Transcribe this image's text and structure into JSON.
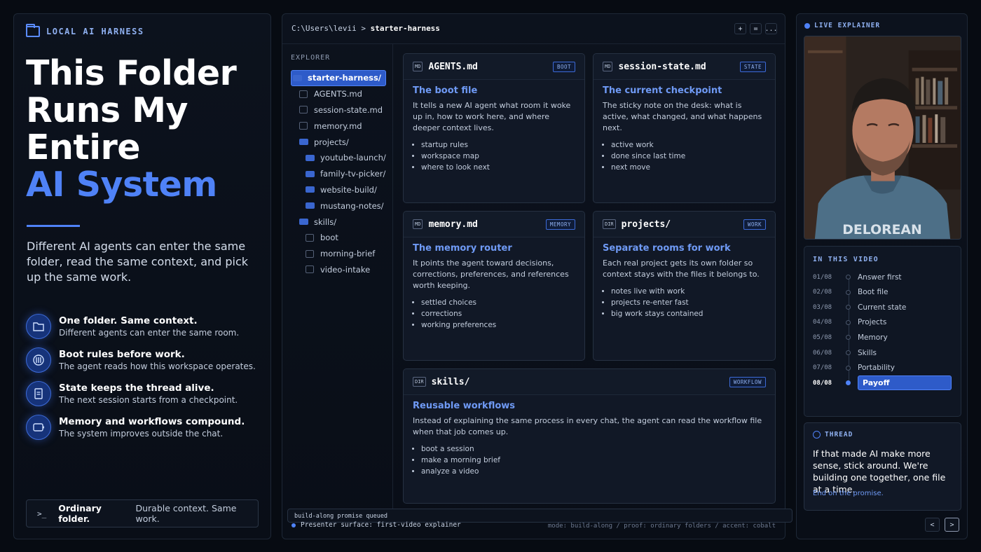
{
  "left": {
    "brand": "LOCAL AI HARNESS",
    "headline": [
      "This Folder",
      "Runs My",
      "Entire"
    ],
    "headline_accent": "AI System",
    "lede": "Different AI agents can enter the same folder, read the same context, and pick up the same work.",
    "features": [
      {
        "icon": "folder-icon",
        "title": "One folder. Same context.",
        "desc": "Different agents can enter the same room."
      },
      {
        "icon": "rules-icon",
        "title": "Boot rules before work.",
        "desc": "The agent reads how this workspace operates."
      },
      {
        "icon": "document-icon",
        "title": "State keeps the thread alive.",
        "desc": "The next session starts from a checkpoint."
      },
      {
        "icon": "workflow-icon",
        "title": "Memory and workflows compound.",
        "desc": "The system improves outside the chat."
      }
    ],
    "footer": {
      "prompt": ">_",
      "bold": "Ordinary folder.",
      "rest": "Durable context. Same work."
    }
  },
  "center": {
    "path_prefix": "C:\\Users\\levii > ",
    "path_current": "starter-harness",
    "window_buttons": [
      "+",
      "=",
      "..."
    ],
    "explorer_header": "EXPLORER",
    "tree": [
      {
        "label": "starter-harness/",
        "type": "folder",
        "depth": 0,
        "selected": true
      },
      {
        "label": "AGENTS.md",
        "type": "file",
        "depth": 1
      },
      {
        "label": "session-state.md",
        "type": "file",
        "depth": 1
      },
      {
        "label": "memory.md",
        "type": "file",
        "depth": 1
      },
      {
        "label": "projects/",
        "type": "folder",
        "depth": 1
      },
      {
        "label": "youtube-launch/",
        "type": "folder",
        "depth": 2
      },
      {
        "label": "family-tv-picker/",
        "type": "folder",
        "depth": 2
      },
      {
        "label": "website-build/",
        "type": "folder",
        "depth": 2
      },
      {
        "label": "mustang-notes/",
        "type": "folder",
        "depth": 2
      },
      {
        "label": "skills/",
        "type": "folder",
        "depth": 1
      },
      {
        "label": "boot",
        "type": "file",
        "depth": 2
      },
      {
        "label": "morning-brief",
        "type": "file",
        "depth": 2
      },
      {
        "label": "video-intake",
        "type": "file",
        "depth": 2
      }
    ],
    "cards": [
      {
        "tag": "MD",
        "name": "AGENTS.md",
        "kind": "BOOT",
        "title": "The boot file",
        "desc": "It tells a new AI agent what room it woke up in, how to work here, and where deeper context lives.",
        "bullets": [
          "startup rules",
          "workspace map",
          "where to look next"
        ]
      },
      {
        "tag": "MD",
        "name": "session-state.md",
        "kind": "STATE",
        "title": "The current checkpoint",
        "desc": "The sticky note on the desk: what is active, what changed, and what happens next.",
        "bullets": [
          "active work",
          "done since last time",
          "next move"
        ]
      },
      {
        "tag": "MD",
        "name": "memory.md",
        "kind": "MEMORY",
        "title": "The memory router",
        "desc": "It points the agent toward decisions, corrections, preferences, and references worth keeping.",
        "bullets": [
          "settled choices",
          "corrections",
          "working preferences"
        ]
      },
      {
        "tag": "DIR",
        "name": "projects/",
        "kind": "WORK",
        "title": "Separate rooms for work",
        "desc": "Each real project gets its own folder so context stays with the files it belongs to.",
        "bullets": [
          "notes live with work",
          "projects re-enter fast",
          "big work stays contained"
        ]
      },
      {
        "tag": "DIR",
        "name": "skills/",
        "kind": "WORKFLOW",
        "title": "Reusable workflows",
        "desc": "Instead of explaining the same process in every chat, the agent can read the workflow file when that job comes up.",
        "bullets": [
          "boot a session",
          "make a morning brief",
          "analyze a video"
        ]
      }
    ],
    "status_queue": "build-along promise queued",
    "presenter": "Presenter surface: first-video explainer",
    "mode_line": "mode: build-along / proof: ordinary folders / accent: cobalt"
  },
  "right": {
    "live_label": "LIVE EXPLAINER",
    "video_shirt_text": "DELOREAN",
    "chapters_header": "IN THIS VIDEO",
    "chapters": [
      {
        "num": "01/08",
        "label": "Answer first"
      },
      {
        "num": "02/08",
        "label": "Boot file"
      },
      {
        "num": "03/08",
        "label": "Current state"
      },
      {
        "num": "04/08",
        "label": "Projects"
      },
      {
        "num": "05/08",
        "label": "Memory"
      },
      {
        "num": "06/08",
        "label": "Skills"
      },
      {
        "num": "07/08",
        "label": "Portability"
      },
      {
        "num": "08/08",
        "label": "Payoff",
        "active": true
      }
    ],
    "thread": {
      "header": "THREAD",
      "message": "If that made AI make more sense, stick around. We're building one together, one file at a time.",
      "sub": "End on the promise."
    },
    "nav": {
      "prev": "<",
      "next": ">"
    }
  },
  "colors": {
    "accent": "#4f82f7",
    "background": "#070b12",
    "panel": "#0c121d"
  }
}
